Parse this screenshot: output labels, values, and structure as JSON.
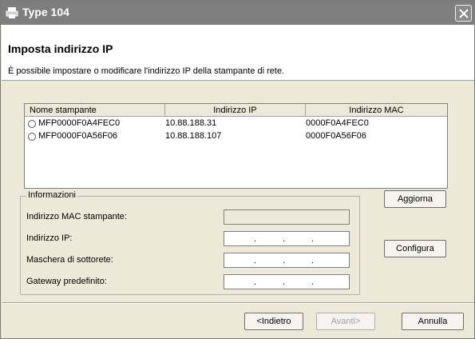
{
  "window": {
    "title": "Type 104"
  },
  "header": {
    "title": "Imposta indirizzo IP",
    "subtitle": "È possibile impostare o modificare l'indirizzo IP della stampante di rete."
  },
  "printer_list": {
    "columns": [
      "Nome stampante",
      "Indirizzo IP",
      "Indirizzo MAC"
    ],
    "rows": [
      {
        "name": "MFP0000F0A4FEC0",
        "ip": "10.88.188.31",
        "mac": "0000F0A4FEC0"
      },
      {
        "name": "MFP0000F0A56F06",
        "ip": "10.88.188.107",
        "mac": "0000F0A56F06"
      }
    ]
  },
  "info": {
    "legend": "Informazioni",
    "mac_label": "Indirizzo MAC stampante:",
    "ip_label": "Indirizzo IP:",
    "mask_label": "Maschera di sottorete:",
    "gateway_label": "Gateway predefinito:",
    "dot": "."
  },
  "buttons": {
    "refresh": "Aggiorna",
    "configure": "Configura",
    "back": "<Indietro",
    "next": "Avanti>",
    "cancel": "Annulla"
  },
  "icons": {
    "app": "printer-network-icon",
    "close": "close-icon"
  }
}
